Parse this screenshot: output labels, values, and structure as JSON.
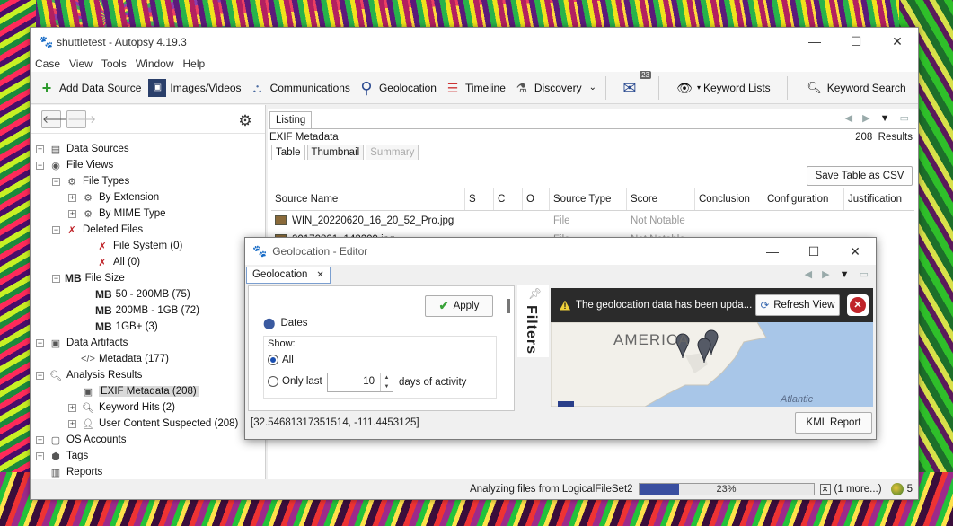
{
  "main_window": {
    "title": "shuttletest - Autopsy 4.19.3",
    "menu": [
      "Case",
      "View",
      "Tools",
      "Window",
      "Help"
    ],
    "controls": {
      "minimize": "—",
      "maximize": "☐",
      "close": "✕"
    }
  },
  "toolbar": {
    "add_data_source": "Add Data Source",
    "images_videos": "Images/Videos",
    "communications": "Communications",
    "geolocation": "Geolocation",
    "timeline": "Timeline",
    "discovery": "Discovery",
    "mail_badge": "23",
    "keyword_lists": "Keyword Lists",
    "keyword_search": "Keyword Search"
  },
  "tree": [
    {
      "label": "Data Sources",
      "expander": "+"
    },
    {
      "label": "File Views",
      "expander": "−"
    },
    {
      "label": "File Types",
      "expander": "−"
    },
    {
      "label": "By Extension",
      "expander": "+"
    },
    {
      "label": "By MIME Type",
      "expander": "+"
    },
    {
      "label": "Deleted Files",
      "expander": "−"
    },
    {
      "label": "File System (0)"
    },
    {
      "label": "All (0)"
    },
    {
      "label": "File Size",
      "expander": "−",
      "prefix": "MB"
    },
    {
      "label": "50 - 200MB (75)",
      "prefix": "MB"
    },
    {
      "label": "200MB - 1GB (72)",
      "prefix": "MB"
    },
    {
      "label": "1GB+ (3)",
      "prefix": "MB"
    },
    {
      "label": "Data Artifacts",
      "expander": "−"
    },
    {
      "label": "Metadata (177)"
    },
    {
      "label": "Analysis Results",
      "expander": "−"
    },
    {
      "label": "EXIF Metadata (208)"
    },
    {
      "label": "Keyword Hits (2)",
      "expander": "+"
    },
    {
      "label": "User Content Suspected (208)",
      "expander": "+"
    },
    {
      "label": "OS Accounts",
      "expander": "+"
    },
    {
      "label": "Tags",
      "expander": "+"
    },
    {
      "label": "Reports"
    }
  ],
  "listing": {
    "tab": "Listing",
    "header": "EXIF Metadata",
    "result_count": "208",
    "results_label": "Results",
    "subtabs": [
      "Table",
      "Thumbnail",
      "Summary"
    ],
    "save_csv": "Save Table as CSV",
    "columns": [
      "Source Name",
      "S",
      "C",
      "O",
      "Source Type",
      "Score",
      "Conclusion",
      "Configuration",
      "Justification"
    ],
    "rows": [
      {
        "name": "WIN_20220620_16_20_52_Pro.jpg",
        "source_type": "File",
        "score": "Not Notable"
      },
      {
        "name": "20170821_143209.jpg",
        "source_type": "File",
        "score": "Not Notable"
      }
    ]
  },
  "geo_editor": {
    "title": "Geolocation - Editor",
    "tab": "Geolocation",
    "apply": "Apply",
    "dates": "Dates",
    "show": "Show:",
    "all": "All",
    "only_last": "Only last",
    "days_value": "10",
    "days_label": "days of activity",
    "filters": "Filters",
    "notice": "The geolocation data has been upda...",
    "refresh": "Refresh View",
    "map_label_america": "AMERICA",
    "map_label_atlantic": "Atlantic",
    "coords": "[32.54681317351514, -111.4453125]",
    "kml_report": "KML Report"
  },
  "status": {
    "text": "Analyzing files from LogicalFileSet2",
    "progress_pct": "23%",
    "progress_value": 0.23,
    "more": "(1 more...)",
    "notifications": "5"
  }
}
